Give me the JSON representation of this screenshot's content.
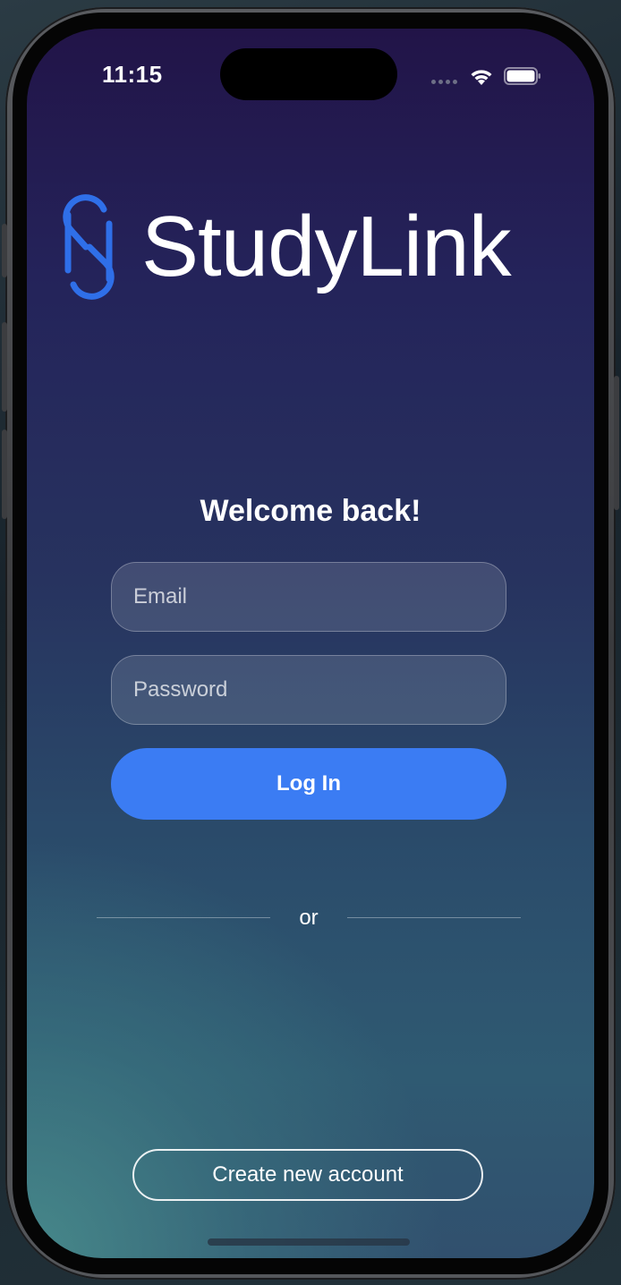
{
  "status_bar": {
    "time": "11:15",
    "icons": [
      "cellular-signal-icon",
      "wifi-icon",
      "battery-icon"
    ]
  },
  "app": {
    "name": "StudyLink",
    "logo_icon": "link-icon"
  },
  "login": {
    "heading": "Welcome back!",
    "email_placeholder": "Email",
    "email_value": "",
    "password_placeholder": "Password",
    "password_value": "",
    "login_label": "Log In",
    "divider_text": "or",
    "create_account_label": "Create new account"
  },
  "colors": {
    "accent": "#3b7cf3",
    "logo_blue": "#2f6fe8",
    "background_top": "#221448",
    "background_bottom_left": "#488c8c"
  }
}
